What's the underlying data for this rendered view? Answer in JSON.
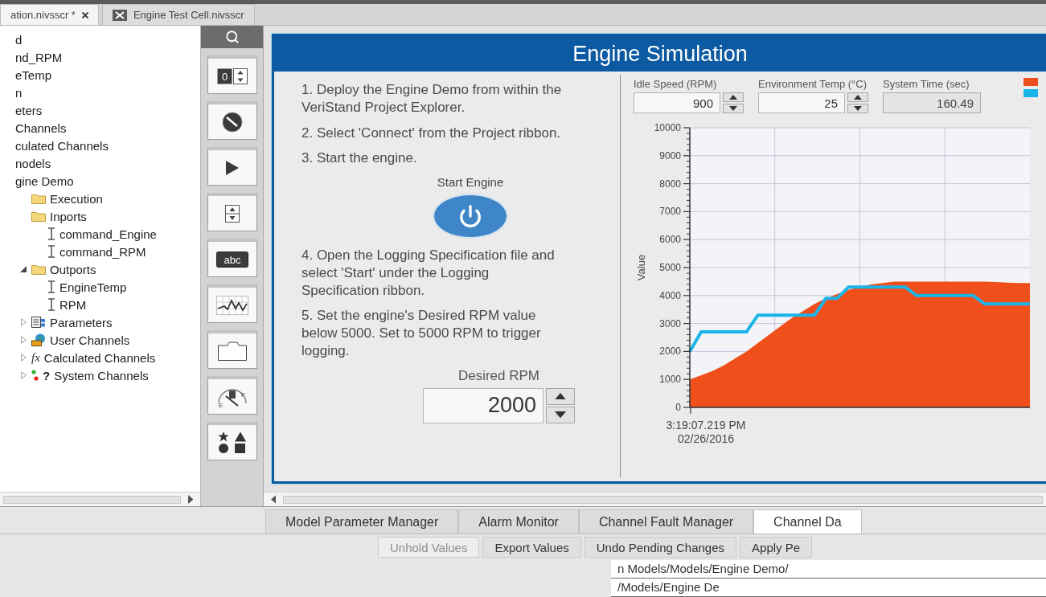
{
  "doc_tabs": [
    {
      "label": "ation.nivsscr *",
      "selected": true,
      "closable": true,
      "has_icon": false
    },
    {
      "label": "Engine Test Cell.nivsscr",
      "selected": false,
      "closable": false,
      "has_icon": true
    }
  ],
  "tree": {
    "items": [
      {
        "label": "d"
      },
      {
        "label": "nd_RPM"
      },
      {
        "label": "eTemp"
      },
      {
        "label": "n"
      },
      {
        "label": "eters"
      },
      {
        "label": "Channels"
      },
      {
        "label": "culated Channels"
      },
      {
        "label": "nodels"
      },
      {
        "label": "gine Demo",
        "children": [
          {
            "label": "Execution",
            "kind": "folder"
          },
          {
            "label": "Inports",
            "kind": "folder",
            "children": [
              {
                "label": "command_Engine",
                "kind": "channel"
              },
              {
                "label": "command_RPM",
                "kind": "channel"
              }
            ]
          },
          {
            "label": "Outports",
            "kind": "folder",
            "expanded": true,
            "children": [
              {
                "label": "EngineTemp",
                "kind": "channel"
              },
              {
                "label": "RPM",
                "kind": "channel"
              }
            ]
          },
          {
            "label": "Parameters",
            "kind": "parameters",
            "expanded": false
          },
          {
            "label": "User Channels",
            "kind": "user-channels",
            "expanded": false
          },
          {
            "label": "Calculated Channels",
            "kind": "calculated",
            "glyph": "fx",
            "expanded": false
          },
          {
            "label": "System Channels",
            "kind": "system",
            "glyph": "?",
            "expanded": false
          }
        ]
      }
    ]
  },
  "palette": {
    "items": [
      {
        "kind": "numeric",
        "glyph": "0"
      },
      {
        "kind": "knob"
      },
      {
        "kind": "boolean"
      },
      {
        "kind": "spinner"
      },
      {
        "kind": "string",
        "glyph": "abc"
      },
      {
        "kind": "graph"
      },
      {
        "kind": "container"
      },
      {
        "kind": "gauge",
        "glyphs": [
          "E",
          "F"
        ]
      },
      {
        "kind": "shapes"
      }
    ]
  },
  "panel": {
    "title": "Engine Simulation",
    "content": [
      {
        "kind": "step",
        "text": "1. Deploy the Engine Demo from within the VeriStand Project Explorer."
      },
      {
        "kind": "step",
        "text": "2. Select 'Connect' from the Project ribbon."
      },
      {
        "kind": "step",
        "text": "3. Start the engine."
      },
      {
        "kind": "power-button",
        "label": "Start Engine"
      },
      {
        "kind": "step",
        "text": "4. Open the Logging Specification file and select 'Start' under the Logging Specification ribbon."
      },
      {
        "kind": "step",
        "text": "5. Set the engine's Desired RPM value below 5000. Set to 5000 RPM to trigger logging."
      },
      {
        "kind": "numeric",
        "label": "Desired RPM",
        "value": "2000"
      }
    ],
    "controls": [
      {
        "kind": "control",
        "label": "Idle Speed (RPM)",
        "value": "900"
      },
      {
        "kind": "control",
        "label": "Environment Temp (°C)",
        "value": "25"
      },
      {
        "kind": "indicator",
        "label": "System Time (sec)",
        "value": "160.49"
      }
    ],
    "chart_data": {
      "type": "line",
      "ylabel": "Value",
      "ylim": [
        0,
        10000
      ],
      "yticks": [
        0,
        1000,
        2000,
        3000,
        4000,
        5000,
        6000,
        7000,
        8000,
        9000,
        10000
      ],
      "grid": true,
      "series": [
        {
          "type": "area",
          "color": "#f04e1b",
          "values": [
            1000,
            1150,
            1300,
            1500,
            1750,
            2000,
            2300,
            2600,
            2900,
            3200,
            3450,
            3700,
            3900,
            4050,
            4200,
            4300,
            4400,
            4450,
            4500,
            4500,
            4500,
            4500,
            4500,
            4500,
            4500,
            4500,
            4500,
            4480,
            4460,
            4450,
            4450
          ]
        },
        {
          "type": "line",
          "color": "#1ab4e8",
          "values": [
            2000,
            2700,
            2700,
            2700,
            2700,
            2700,
            3300,
            3300,
            3300,
            3300,
            3300,
            3300,
            3900,
            3900,
            4300,
            4300,
            4300,
            4300,
            4300,
            4300,
            4000,
            4000,
            4000,
            4000,
            4000,
            4000,
            3700,
            3700,
            3700,
            3700,
            3700
          ]
        }
      ],
      "annotations": [
        "3:19:07.219 PM\n02/26/2016"
      ]
    }
  },
  "tool_tabs": [
    {
      "label": "Model Parameter Manager",
      "selected": false
    },
    {
      "label": "Alarm Monitor",
      "selected": false
    },
    {
      "label": "Channel Fault Manager",
      "selected": false
    },
    {
      "label": "Channel Da",
      "selected": true
    }
  ],
  "actions": [
    {
      "label": "Unhold Values",
      "disabled": true
    },
    {
      "label": "Export Values",
      "disabled": false
    },
    {
      "label": "Undo Pending Changes",
      "disabled": false
    },
    {
      "label": "Apply Pe",
      "disabled": false
    }
  ],
  "table": {
    "rows": [
      [
        "n Models/Models/Engine Demo/"
      ],
      [
        "/Models/Engine De"
      ]
    ]
  }
}
